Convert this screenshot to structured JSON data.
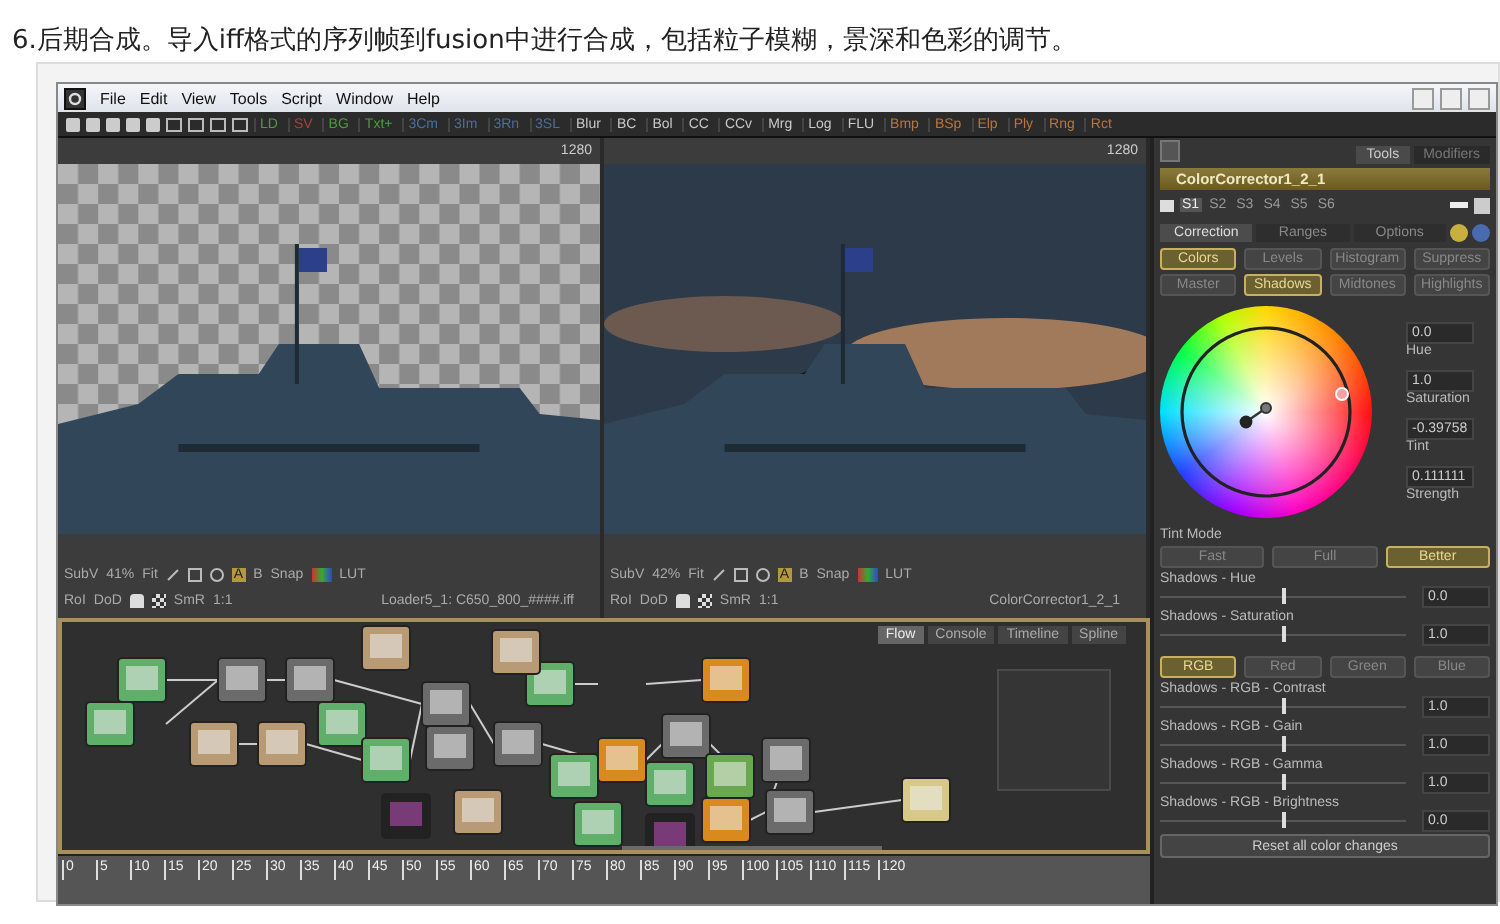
{
  "caption": "6.后期合成。导入iff格式的序列帧到fusion中进行合成，包括粒子模糊，景深和色彩的调节。",
  "menu": [
    "File",
    "Edit",
    "View",
    "Tools",
    "Script",
    "Window",
    "Help"
  ],
  "toolbar": [
    {
      "label": "LD",
      "color": "#4f9a3f"
    },
    {
      "label": "SV",
      "color": "#a8433a"
    },
    {
      "label": "BG",
      "color": "#4f9a3f"
    },
    {
      "label": "Txt+",
      "color": "#4f9a3f"
    },
    {
      "label": "3Cm",
      "color": "#4a6f9c"
    },
    {
      "label": "3Im",
      "color": "#4a6f9c"
    },
    {
      "label": "3Rn",
      "color": "#4a6f9c"
    },
    {
      "label": "3SL",
      "color": "#4a6f9c"
    },
    {
      "label": "Blur",
      "color": "#c8c8c8"
    },
    {
      "label": "BC",
      "color": "#c8c8c8"
    },
    {
      "label": "Bol",
      "color": "#c8c8c8"
    },
    {
      "label": "CC",
      "color": "#c8c8c8"
    },
    {
      "label": "CCv",
      "color": "#c8c8c8"
    },
    {
      "label": "Mrg",
      "color": "#c8c8c8"
    },
    {
      "label": "Log",
      "color": "#c8c8c8"
    },
    {
      "label": "FLU",
      "color": "#c8c8c8"
    },
    {
      "label": "Bmp",
      "color": "#b8763a"
    },
    {
      "label": "BSp",
      "color": "#b8763a"
    },
    {
      "label": "Elp",
      "color": "#b8763a"
    },
    {
      "label": "Ply",
      "color": "#b8763a"
    },
    {
      "label": "Rng",
      "color": "#b8763a"
    },
    {
      "label": "Rct",
      "color": "#b8763a"
    }
  ],
  "viewers": [
    {
      "kind": "alpha",
      "resolution": "1280",
      "subv": "SubV",
      "zoom": "41%",
      "fit": "Fit",
      "a": "A",
      "b": "B",
      "snap": "Snap",
      "lut": "LUT",
      "roi": "RoI",
      "dod": "DoD",
      "smr": "SmR",
      "scale": "1:1",
      "node": "Loader5_1: C650_800_####.iff"
    },
    {
      "kind": "composite",
      "resolution": "1280",
      "subv": "SubV",
      "zoom": "42%",
      "fit": "Fit",
      "a": "A",
      "b": "B",
      "snap": "Snap",
      "lut": "LUT",
      "roi": "RoI",
      "dod": "DoD",
      "smr": "SmR",
      "scale": "1:1",
      "node": "ColorCorrector1_2_1"
    }
  ],
  "flow_tabs": [
    {
      "label": "Flow",
      "selected": true
    },
    {
      "label": "Console",
      "selected": false
    },
    {
      "label": "Timeline",
      "selected": false
    },
    {
      "label": "Spline",
      "selected": false
    }
  ],
  "timeline_ticks": [
    "0",
    "5",
    "10",
    "15",
    "20",
    "25",
    "30",
    "35",
    "40",
    "45",
    "50",
    "55",
    "60",
    "65",
    "70",
    "75",
    "80",
    "85",
    "90",
    "95",
    "100",
    "105",
    "110",
    "115",
    "120"
  ],
  "inspector": {
    "tabs": [
      {
        "label": "Tools",
        "selected": true
      },
      {
        "label": "Modifiers",
        "selected": false
      }
    ],
    "tool_name": "ColorCorrector1_2_1",
    "slots": [
      {
        "label": "S1",
        "selected": true
      },
      {
        "label": "S2",
        "selected": false
      },
      {
        "label": "S3",
        "selected": false
      },
      {
        "label": "S4",
        "selected": false
      },
      {
        "label": "S5",
        "selected": false
      },
      {
        "label": "S6",
        "selected": false
      }
    ],
    "sections": [
      {
        "label": "Correction",
        "selected": true
      },
      {
        "label": "Ranges",
        "selected": false
      },
      {
        "label": "Options",
        "selected": false
      }
    ],
    "modes": [
      {
        "label": "Colors",
        "selected": true
      },
      {
        "label": "Levels",
        "selected": false
      },
      {
        "label": "Histogram",
        "selected": false
      },
      {
        "label": "Suppress",
        "selected": false
      }
    ],
    "ranges": [
      {
        "label": "Master",
        "selected": false
      },
      {
        "label": "Shadows",
        "selected": true
      },
      {
        "label": "Midtones",
        "selected": false
      },
      {
        "label": "Highlights",
        "selected": false
      }
    ],
    "wheel_fields": [
      {
        "value": "0.0",
        "label": "Hue"
      },
      {
        "value": "1.0",
        "label": "Saturation"
      },
      {
        "value": "-0.39758",
        "label": "Tint"
      },
      {
        "value": "0.111111",
        "label": "Strength"
      }
    ],
    "tint_mode": {
      "label": "Tint Mode",
      "options": [
        {
          "label": "Fast",
          "selected": false
        },
        {
          "label": "Full",
          "selected": false
        },
        {
          "label": "Better",
          "selected": true
        }
      ]
    },
    "sliders_top": [
      {
        "label": "Shadows - Hue",
        "value": "0.0",
        "level": 0.5
      },
      {
        "label": "Shadows - Saturation",
        "value": "1.0",
        "level": 0.5
      }
    ],
    "channels": [
      {
        "label": "RGB",
        "selected": true
      },
      {
        "label": "Red",
        "selected": false
      },
      {
        "label": "Green",
        "selected": false
      },
      {
        "label": "Blue",
        "selected": false
      }
    ],
    "sliders_bottom": [
      {
        "label": "Shadows - RGB - Contrast",
        "value": "1.0",
        "level": 0.5
      },
      {
        "label": "Shadows - RGB - Gain",
        "value": "1.0",
        "level": 0.5
      },
      {
        "label": "Shadows - RGB - Gamma",
        "value": "1.0",
        "level": 0.5
      },
      {
        "label": "Shadows - RGB - Brightness",
        "value": "0.0",
        "level": 0.5
      }
    ],
    "reset": "Reset all color changes"
  }
}
